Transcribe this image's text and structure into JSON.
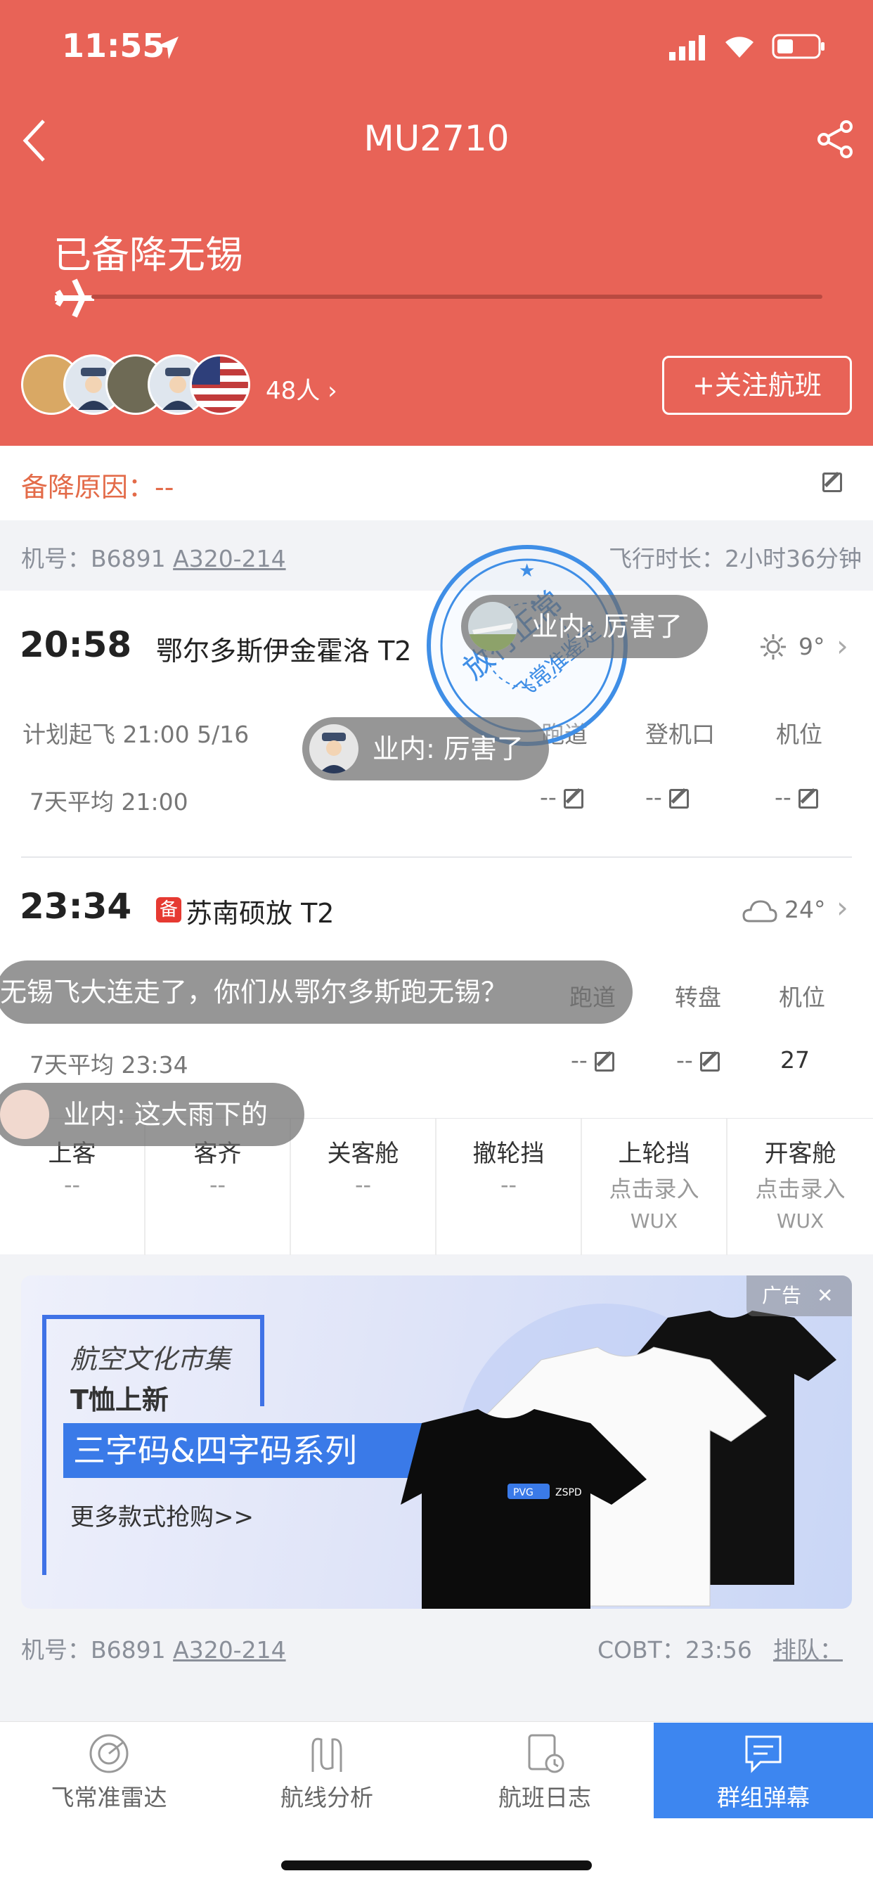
{
  "status": {
    "time": "11:55"
  },
  "header": {
    "flight_no": "MU2710",
    "status_text": "已备降无锡",
    "followers": "48人",
    "follow_button": "+关注航班"
  },
  "diversion": {
    "reason": "备降原因：--"
  },
  "aircraft_top": {
    "reg_label": "机号：",
    "reg": "B6891",
    "model": "A320-214",
    "duration": "飞行时长：2小时36分钟"
  },
  "departure": {
    "time": "20:58",
    "airport": "鄂尔多斯伊金霍洛 T2",
    "weather_temp": "9°",
    "planned": "计划起飞 21:00 5/16",
    "avg": "7天平均 21:00",
    "cols": [
      "跑道",
      "登机口",
      "机位"
    ],
    "vals": [
      "--",
      "--",
      "--"
    ]
  },
  "arrival": {
    "time": "23:34",
    "badge": "备",
    "airport": "苏南硕放 T2",
    "weather_temp": "24°",
    "avg": "7天平均 23:34",
    "cols": [
      "跑道",
      "转盘",
      "机位"
    ],
    "vals": [
      "--",
      "--",
      "27"
    ]
  },
  "ground": [
    {
      "label": "上客",
      "value": "--",
      "sub": ""
    },
    {
      "label": "客齐",
      "value": "--",
      "sub": ""
    },
    {
      "label": "关客舱",
      "value": "--",
      "sub": ""
    },
    {
      "label": "撤轮挡",
      "value": "--",
      "sub": ""
    },
    {
      "label": "上轮挡",
      "value": "点击录入",
      "sub": "WUX"
    },
    {
      "label": "开客舱",
      "value": "点击录入",
      "sub": "WUX"
    }
  ],
  "ad": {
    "tag": "广告",
    "line1": "航空文化市集",
    "line2": "T恤上新",
    "highlight": "三字码&四字码系列",
    "cta": "更多款式抢购>>",
    "tshirt_label1": "PVG",
    "tshirt_label2": "ZSPD"
  },
  "aircraft_bottom": {
    "reg_label": "机号：",
    "reg": "B6891",
    "model": "A320-214",
    "cobt": "COBT：23:56",
    "queue": "排队："
  },
  "stamp": {
    "text1": "放行正常",
    "text2": "飞常准鉴定"
  },
  "danmu": [
    "业内: 厉害了",
    "业内: 厉害了",
    "无锡飞大连走了，你们从鄂尔多斯跑无锡？",
    "业内: 这大雨下的"
  ],
  "bottom_nav": [
    {
      "label": "飞常准雷达",
      "icon": "radar-icon"
    },
    {
      "label": "航线分析",
      "icon": "route-icon"
    },
    {
      "label": "航班日志",
      "icon": "log-icon"
    },
    {
      "label": "群组弹幕",
      "icon": "chat-icon"
    }
  ],
  "colors": {
    "header": "#e86357",
    "accent_blue": "#3d86f0",
    "stamp_blue": "#3f8ee6"
  }
}
